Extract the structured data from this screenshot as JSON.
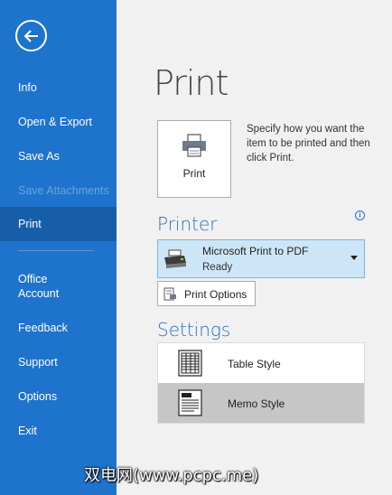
{
  "sidebar": {
    "items": [
      {
        "label": "Info"
      },
      {
        "label": "Open & Export"
      },
      {
        "label": "Save As"
      },
      {
        "label": "Save Attachments"
      },
      {
        "label": "Print"
      },
      {
        "label_line1": "Office",
        "label_line2": "Account"
      },
      {
        "label": "Feedback"
      },
      {
        "label": "Support"
      },
      {
        "label": "Options"
      },
      {
        "label": "Exit"
      }
    ]
  },
  "main": {
    "title": "Print",
    "print_button_label": "Print",
    "description": "Specify how you want the item to be printed and then click Print.",
    "printer_section": {
      "title": "Printer",
      "selected_printer": "Microsoft Print to PDF",
      "status": "Ready",
      "options_button": "Print Options"
    },
    "settings_section": {
      "title": "Settings",
      "styles": [
        {
          "label": "Table Style",
          "selected": false
        },
        {
          "label": "Memo Style",
          "selected": true
        }
      ]
    }
  },
  "watermark": "双电网(www.pcpc.me)",
  "colors": {
    "sidebar_bg": "#1e73cc",
    "sidebar_selected": "#175ea9",
    "accent": "#2b70c2",
    "printer_highlight": "#cde6f7",
    "style_selected": "#c6c6c6"
  }
}
